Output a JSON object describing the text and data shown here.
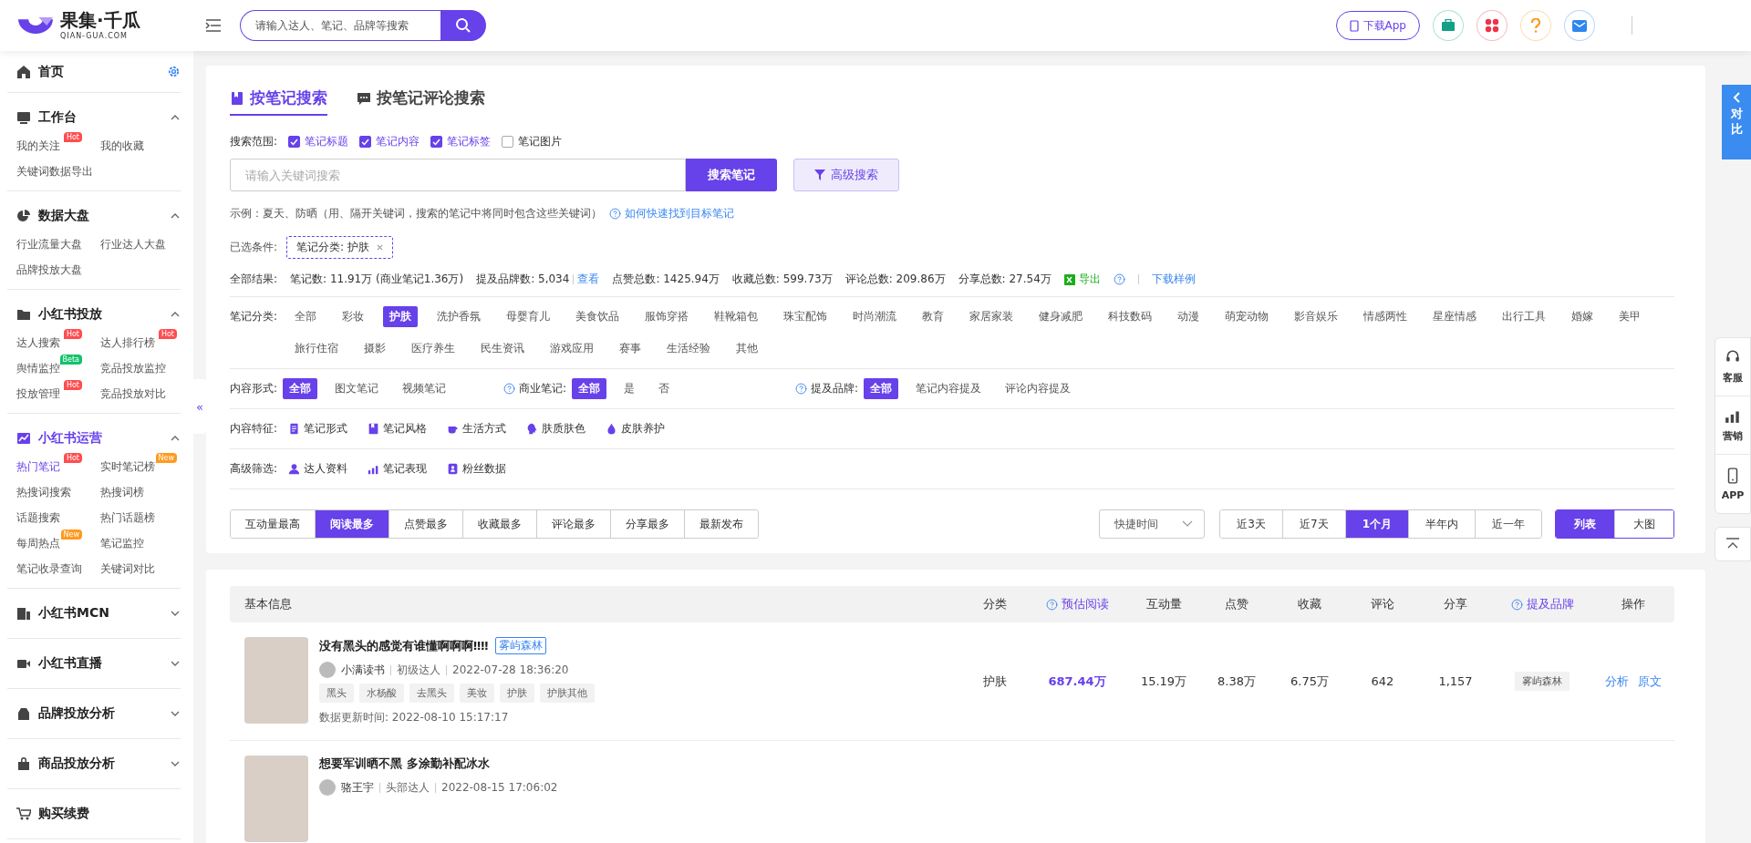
{
  "header": {
    "logo": {
      "name": "果集·千瓜",
      "sub": "QIAN-GUA.COM"
    },
    "search": {
      "placeholder": "请输入达人、笔记、品牌等搜索"
    },
    "download": "下载App"
  },
  "sidebar": {
    "home": "首页",
    "collapse": "«",
    "sections": [
      {
        "title": "工作台",
        "expanded": true,
        "selected": false,
        "items": [
          {
            "label": "我的关注",
            "selected": false,
            "badge": {
              "text": "Hot",
              "color": "#ff4d4f"
            }
          },
          {
            "label": "我的收藏",
            "selected": false
          },
          {
            "label": "关键词数据导出",
            "selected": false
          }
        ]
      },
      {
        "title": "数据大盘",
        "expanded": true,
        "selected": false,
        "items": [
          {
            "label": "行业流量大盘",
            "selected": false
          },
          {
            "label": "行业达人大盘",
            "selected": false
          },
          {
            "label": "品牌投放大盘",
            "selected": false
          }
        ]
      },
      {
        "title": "小红书投放",
        "expanded": true,
        "selected": false,
        "items": [
          {
            "label": "达人搜索",
            "selected": false,
            "badge": {
              "text": "Hot",
              "color": "#ff4d4f"
            }
          },
          {
            "label": "达人排行榜",
            "selected": false,
            "badge": {
              "text": "Hot",
              "color": "#ff4d4f"
            }
          },
          {
            "label": "舆情监控",
            "selected": false,
            "badge": {
              "text": "Beta",
              "color": "#13c26b"
            }
          },
          {
            "label": "竞品投放监控",
            "selected": false
          },
          {
            "label": "投放管理",
            "selected": false,
            "badge": {
              "text": "Hot",
              "color": "#ff4d4f"
            }
          },
          {
            "label": "竞品投放对比",
            "selected": false
          }
        ]
      },
      {
        "title": "小红书运营",
        "expanded": true,
        "selected": true,
        "items": [
          {
            "label": "热门笔记",
            "selected": true,
            "badge": {
              "text": "Hot",
              "color": "#ff4d4f"
            }
          },
          {
            "label": "实时笔记榜",
            "selected": false,
            "badge": {
              "text": "New",
              "color": "#ff9a1f"
            }
          },
          {
            "label": "热搜词搜索",
            "selected": false
          },
          {
            "label": "热搜词榜",
            "selected": false
          },
          {
            "label": "话题搜索",
            "selected": false
          },
          {
            "label": "热门话题榜",
            "selected": false
          },
          {
            "label": "每周热点",
            "selected": false,
            "badge": {
              "text": "New",
              "color": "#ff9a1f"
            }
          },
          {
            "label": "笔记监控",
            "selected": false
          },
          {
            "label": "笔记收录查询",
            "selected": false
          },
          {
            "label": "关键词对比",
            "selected": false
          }
        ]
      },
      {
        "title": "小红书MCN",
        "expanded": false,
        "selected": false
      },
      {
        "title": "小红书直播",
        "expanded": false,
        "selected": false
      },
      {
        "title": "品牌投放分析",
        "expanded": false,
        "selected": false
      },
      {
        "title": "商品投放分析",
        "expanded": false,
        "selected": false
      },
      {
        "title": "购买续费",
        "selected": false
      }
    ]
  },
  "search_panel": {
    "tabs": [
      {
        "label": "按笔记搜索",
        "selected": true
      },
      {
        "label": "按笔记评论搜索",
        "selected": false
      }
    ],
    "scope": {
      "label": "搜索范围:",
      "options": [
        {
          "label": "笔记标题",
          "checked": true
        },
        {
          "label": "笔记内容",
          "checked": true
        },
        {
          "label": "笔记标签",
          "checked": true
        },
        {
          "label": "笔记图片",
          "checked": false
        }
      ]
    },
    "keyword": {
      "placeholder": "请输入关键词搜索"
    },
    "search_button": "搜索笔记",
    "advanced_button": "高级搜索",
    "example": "示例：夏天、防晒（用、隔开关键词，搜索的笔记中将同时包含这些关键词）",
    "help_link": "如何快速找到目标笔记",
    "conditions": {
      "label": "已选条件:",
      "chips": [
        "笔记分类: 护肤"
      ]
    },
    "stats": {
      "label": "全部结果:",
      "items": [
        {
          "label": "笔记数:",
          "value": "11.91万",
          "note": "(商业笔记1.36万)"
        },
        {
          "label": "提及品牌数:",
          "value": "5,034",
          "link": "查看"
        },
        {
          "label": "点赞总数:",
          "value": "1425.94万"
        },
        {
          "label": "收藏总数:",
          "value": "599.73万"
        },
        {
          "label": "评论总数:",
          "value": "209.86万"
        },
        {
          "label": "分享总数:",
          "value": "27.54万"
        }
      ],
      "export": "导出",
      "sample": "下载样例"
    },
    "categories": {
      "label": "笔记分类:",
      "options": [
        {
          "label": "全部",
          "selected": false
        },
        {
          "label": "彩妆",
          "selected": false
        },
        {
          "label": "护肤",
          "selected": true
        },
        {
          "label": "洗护香氛",
          "selected": false
        },
        {
          "label": "母婴育儿",
          "selected": false
        },
        {
          "label": "美食饮品",
          "selected": false
        },
        {
          "label": "服饰穿搭",
          "selected": false
        },
        {
          "label": "鞋靴箱包",
          "selected": false
        },
        {
          "label": "珠宝配饰",
          "selected": false
        },
        {
          "label": "时尚潮流",
          "selected": false
        },
        {
          "label": "教育",
          "selected": false
        },
        {
          "label": "家居家装",
          "selected": false
        },
        {
          "label": "健身减肥",
          "selected": false
        },
        {
          "label": "科技数码",
          "selected": false
        },
        {
          "label": "动漫",
          "selected": false
        },
        {
          "label": "萌宠动物",
          "selected": false
        },
        {
          "label": "影音娱乐",
          "selected": false
        },
        {
          "label": "情感两性",
          "selected": false
        },
        {
          "label": "星座情感",
          "selected": false
        },
        {
          "label": "出行工具",
          "selected": false
        },
        {
          "label": "婚嫁",
          "selected": false
        },
        {
          "label": "美甲",
          "selected": false
        },
        {
          "label": "旅行住宿",
          "selected": false
        },
        {
          "label": "摄影",
          "selected": false
        },
        {
          "label": "医疗养生",
          "selected": false
        },
        {
          "label": "民生资讯",
          "selected": false
        },
        {
          "label": "游戏应用",
          "selected": false
        },
        {
          "label": "赛事",
          "selected": false
        },
        {
          "label": "生活经验",
          "selected": false
        },
        {
          "label": "其他",
          "selected": false
        }
      ]
    },
    "filter_groups": [
      {
        "label": "内容形式:",
        "help": false,
        "options": [
          {
            "label": "全部",
            "selected": true
          },
          {
            "label": "图文笔记",
            "selected": false
          },
          {
            "label": "视频笔记",
            "selected": false
          }
        ]
      },
      {
        "label": "商业笔记:",
        "help": true,
        "options": [
          {
            "label": "全部",
            "selected": true
          },
          {
            "label": "是",
            "selected": false
          },
          {
            "label": "否",
            "selected": false
          }
        ]
      },
      {
        "label": "提及品牌:",
        "help": true,
        "options": [
          {
            "label": "全部",
            "selected": true
          },
          {
            "label": "笔记内容提及",
            "selected": false
          },
          {
            "label": "评论内容提及",
            "selected": false
          }
        ]
      }
    ],
    "features": {
      "label": "内容特征:",
      "items": [
        "笔记形式",
        "笔记风格",
        "生活方式",
        "肤质肤色",
        "皮肤养护"
      ]
    },
    "advanced": {
      "label": "高级筛选:",
      "items": [
        "达人资料",
        "笔记表现",
        "粉丝数据"
      ]
    },
    "sort": [
      {
        "label": "互动量最高",
        "selected": false
      },
      {
        "label": "阅读最多",
        "selected": true
      },
      {
        "label": "点赞最多",
        "selected": false
      },
      {
        "label": "收藏最多",
        "selected": false
      },
      {
        "label": "评论最多",
        "selected": false
      },
      {
        "label": "分享最多",
        "selected": false
      },
      {
        "label": "最新发布",
        "selected": false
      }
    ],
    "quick_time": {
      "placeholder": "快捷时间"
    },
    "ranges": [
      {
        "label": "近3天",
        "selected": false
      },
      {
        "label": "近7天",
        "selected": false
      },
      {
        "label": "1个月",
        "selected": true
      },
      {
        "label": "半年内",
        "selected": false
      },
      {
        "label": "近一年",
        "selected": false
      }
    ],
    "views": [
      {
        "label": "列表",
        "selected": true
      },
      {
        "label": "大图",
        "selected": false
      }
    ]
  },
  "table": {
    "columns": [
      {
        "label": "基本信息",
        "help": false
      },
      {
        "label": "分类",
        "help": false
      },
      {
        "label": "预估阅读",
        "help": true
      },
      {
        "label": "互动量",
        "help": false
      },
      {
        "label": "点赞",
        "help": false
      },
      {
        "label": "收藏",
        "help": false
      },
      {
        "label": "评论",
        "help": false
      },
      {
        "label": "分享",
        "help": false
      },
      {
        "label": "提及品牌",
        "help": true
      },
      {
        "label": "操作",
        "help": false
      }
    ],
    "rows": [
      {
        "title": "没有黑头的感觉有谁懂啊啊啊‼‼",
        "brand_tag": "雾屿森林",
        "author": "小满读书",
        "level": "初级达人",
        "date": "2022-07-28 18:36:20",
        "tags": [
          "黑头",
          "水杨酸",
          "去黑头",
          "美妆",
          "护肤",
          "护肤其他"
        ],
        "updated_label": "数据更新时间:",
        "updated": "2022-08-10 15:17:17",
        "category": "护肤",
        "reads": "687.44万",
        "interactions": "15.19万",
        "likes": "8.38万",
        "collects": "6.75万",
        "comments": "642",
        "shares": "1,157",
        "brand": "雾屿森林",
        "actions": [
          "分析",
          "原文"
        ]
      },
      {
        "title": "想要军训晒不黑 多涂勤补配冰水",
        "author": "骆王宇",
        "level": "头部达人",
        "date": "2022-08-15 17:06:02",
        "tags": []
      }
    ]
  },
  "right_rail": {
    "compare": "对比",
    "tools": [
      "客服",
      "营销",
      "APP"
    ]
  }
}
